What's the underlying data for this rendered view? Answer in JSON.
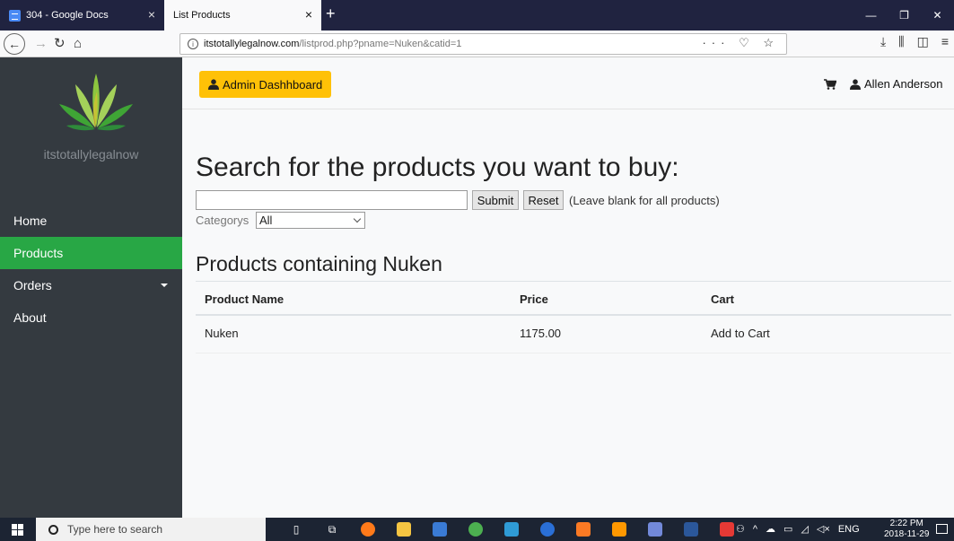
{
  "browser": {
    "tabs": [
      {
        "title": "304 - Google Docs",
        "active": false
      },
      {
        "title": "List Products",
        "active": true
      }
    ],
    "url": {
      "host": "itstotallylegalnow.com",
      "path": "/listprod.php?pname=Nuken&catid=1"
    },
    "url_actions": "··· ♡ ☆"
  },
  "sidebar": {
    "brand": "itstotallylegalnow",
    "items": [
      {
        "label": "Home",
        "active": false
      },
      {
        "label": "Products",
        "active": true
      },
      {
        "label": "Orders",
        "active": false,
        "has_dropdown": true
      },
      {
        "label": "About",
        "active": false
      }
    ]
  },
  "topbar": {
    "admin_button": "Admin Dashhboard",
    "user_name": "Allen Anderson"
  },
  "search": {
    "heading": "Search for the products you want to buy:",
    "input_value": "",
    "submit_label": "Submit",
    "reset_label": "Reset",
    "hint": "(Leave blank for all products)",
    "category_label": "Categorys",
    "category_selected": "All"
  },
  "results": {
    "heading": "Products containing Nuken",
    "columns": [
      "Product Name",
      "Price",
      "Cart"
    ],
    "rows": [
      {
        "name": "Nuken",
        "price": "1175.00",
        "cart": "Add to Cart"
      }
    ]
  },
  "taskbar": {
    "search_placeholder": "Type here to search",
    "language": "ENG",
    "time": "2:22 PM",
    "date": "2018-11-29"
  },
  "colors": {
    "sidebar_bg": "#343a40",
    "active_green": "#28a745",
    "admin_yellow": "#ffc107",
    "tabbar_bg": "#202340"
  }
}
